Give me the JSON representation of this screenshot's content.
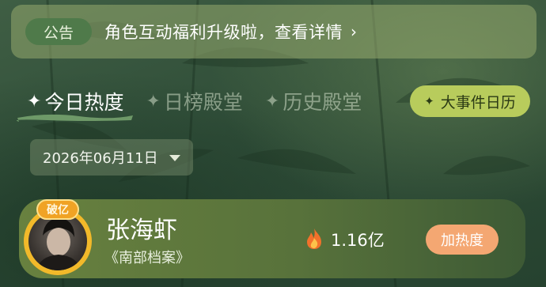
{
  "notice": {
    "tag": "公告",
    "text": "角色互动福利升级啦，查看详情",
    "arrow": "›"
  },
  "tabs": [
    {
      "label": "今日热度",
      "active": true,
      "icon": "sparkle-icon"
    },
    {
      "label": "日榜殿堂",
      "active": false,
      "icon": "sparkle-icon"
    },
    {
      "label": "历史殿堂",
      "active": false,
      "icon": "sparkle-icon"
    }
  ],
  "event_button": {
    "label": "大事件日历",
    "icon": "sparkle-icon"
  },
  "date_select": {
    "value": "2026年06月11日",
    "icon": "caret-down-icon"
  },
  "ranking": [
    {
      "badge": "破亿",
      "name": "张海虾",
      "show": "《南部档案》",
      "heat": "1.16亿",
      "heat_icon": "flame-icon",
      "button": "加热度"
    }
  ],
  "colors": {
    "background": "#2d4a36",
    "notice_bg": "#96aa6e",
    "event_button": "#b8cc5c",
    "heat_button": "#f4a772",
    "badge": "#f0a325"
  }
}
